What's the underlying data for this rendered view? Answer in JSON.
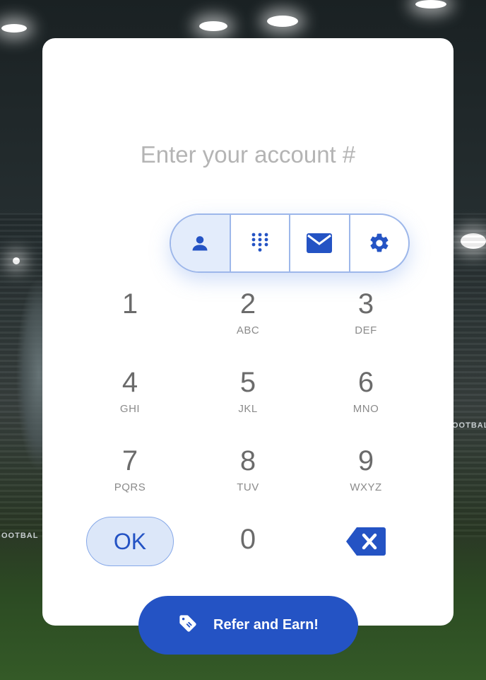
{
  "background": {
    "side_text_left": "OOTBAL",
    "side_text_right": "OOTBALL"
  },
  "prompt": {
    "text": "Enter your account #"
  },
  "mode_selector": {
    "options": [
      {
        "icon": "person-icon",
        "active": true
      },
      {
        "icon": "dialpad-icon",
        "active": false
      },
      {
        "icon": "mail-icon",
        "active": false
      },
      {
        "icon": "gear-icon",
        "active": false
      }
    ]
  },
  "keypad": {
    "keys": [
      {
        "num": "1",
        "letters": ""
      },
      {
        "num": "2",
        "letters": "ABC"
      },
      {
        "num": "3",
        "letters": "DEF"
      },
      {
        "num": "4",
        "letters": "GHI"
      },
      {
        "num": "5",
        "letters": "JKL"
      },
      {
        "num": "6",
        "letters": "MNO"
      },
      {
        "num": "7",
        "letters": "PQRS"
      },
      {
        "num": "8",
        "letters": "TUV"
      },
      {
        "num": "9",
        "letters": "WXYZ"
      },
      {
        "num": "0",
        "letters": ""
      }
    ],
    "ok_label": "OK",
    "delete_icon": "backspace-icon"
  },
  "refer": {
    "label": "Refer and Earn!",
    "icon": "tag-icon"
  },
  "colors": {
    "accent": "#2453c4",
    "active_fill": "#e3ecfb",
    "border": "#9db7ea",
    "card": "#ffffff"
  }
}
